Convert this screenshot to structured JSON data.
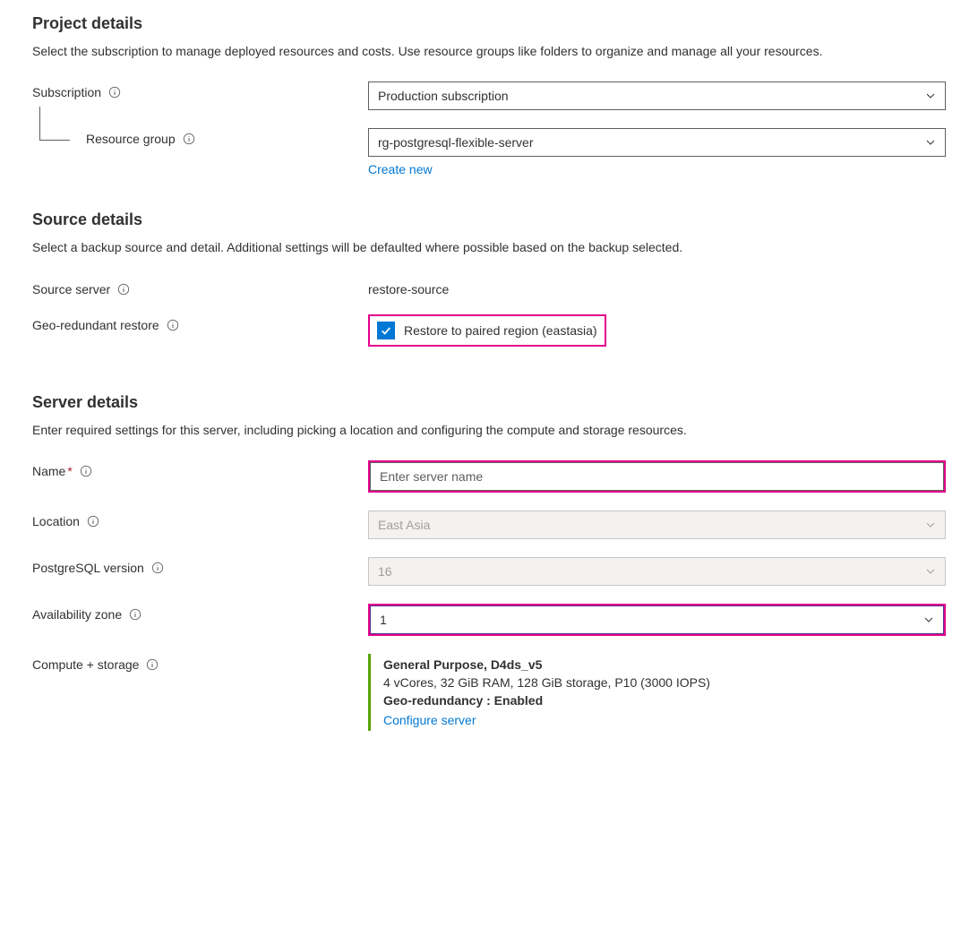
{
  "project_details": {
    "heading": "Project details",
    "desc": "Select the subscription to manage deployed resources and costs. Use resource groups like folders to organize and manage all your resources.",
    "subscription_label": "Subscription",
    "subscription_value": "Production subscription",
    "resource_group_label": "Resource group",
    "resource_group_value": "rg-postgresql-flexible-server",
    "create_new": "Create new"
  },
  "source_details": {
    "heading": "Source details",
    "desc": "Select a backup source and detail. Additional settings will be defaulted where possible based on the backup selected.",
    "source_server_label": "Source server",
    "source_server_value": "restore-source",
    "geo_restore_label": "Geo-redundant restore",
    "geo_restore_checkbox_label": "Restore to paired region (eastasia)"
  },
  "server_details": {
    "heading": "Server details",
    "desc": "Enter required settings for this server, including picking a location and configuring the compute and storage resources.",
    "name_label": "Name",
    "name_placeholder": "Enter server name",
    "location_label": "Location",
    "location_value": "East Asia",
    "pg_version_label": "PostgreSQL version",
    "pg_version_value": "16",
    "az_label": "Availability zone",
    "az_value": "1",
    "compute_label": "Compute + storage",
    "compute_title": "General Purpose, D4ds_v5",
    "compute_specs": "4 vCores, 32 GiB RAM, 128 GiB storage, P10 (3000 IOPS)",
    "compute_geo": "Geo-redundancy : Enabled",
    "configure_server": "Configure server"
  }
}
